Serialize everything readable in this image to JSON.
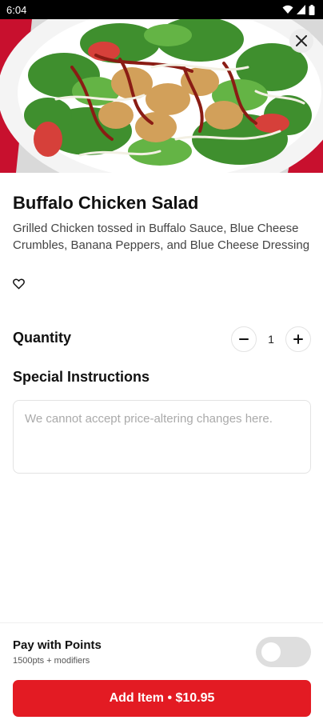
{
  "status_bar": {
    "time": "6:04",
    "icons": [
      "wifi-icon",
      "cell-signal-icon",
      "battery-icon"
    ]
  },
  "hero": {
    "image": "buffalo-chicken-salad-photo",
    "close_icon": "close-icon"
  },
  "item": {
    "title": "Buffalo Chicken Salad",
    "description": "Grilled Chicken tossed in Buffalo Sauce, Blue Cheese Crumbles, Banana Peppers, and Blue Cheese Dressing",
    "favorite_icon": "heart-icon"
  },
  "quantity": {
    "label": "Quantity",
    "value": "1",
    "decrement_icon": "minus-icon",
    "increment_icon": "plus-icon"
  },
  "special_instructions": {
    "label": "Special Instructions",
    "value": "",
    "placeholder": "We cannot accept price-altering changes here."
  },
  "pay_with_points": {
    "title": "Pay with Points",
    "subtitle": "1500pts + modifiers",
    "enabled": false
  },
  "add_button": {
    "label": "Add Item • $10.95"
  },
  "colors": {
    "accent": "#e31b23",
    "toggle_off": "#dedede",
    "border": "#e3e3e3"
  }
}
